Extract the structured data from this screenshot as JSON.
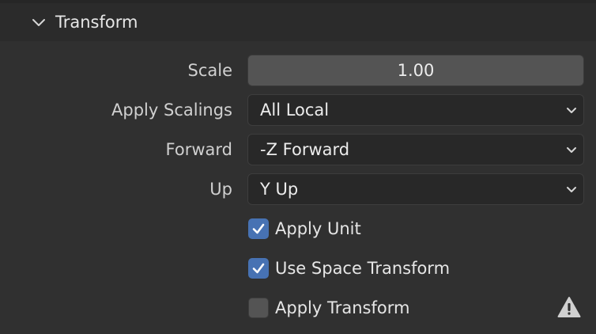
{
  "panel": {
    "title": "Transform",
    "expanded": true,
    "icon": "chevron-down-icon"
  },
  "scale": {
    "label": "Scale",
    "value": "1.00"
  },
  "apply_scalings": {
    "label": "Apply Scalings",
    "value": "All Local"
  },
  "forward": {
    "label": "Forward",
    "value": "-Z Forward"
  },
  "up": {
    "label": "Up",
    "value": "Y Up"
  },
  "apply_unit": {
    "label": "Apply Unit",
    "checked": true
  },
  "use_space_transform": {
    "label": "Use Space Transform",
    "checked": true
  },
  "apply_transform": {
    "label": "Apply Transform",
    "checked": false,
    "icon": "warning-icon"
  },
  "colors": {
    "background": "#303030",
    "header": "#2b2b2b",
    "accent": "#4772b3",
    "numfield": "#545454",
    "dropdown": "#282828"
  }
}
